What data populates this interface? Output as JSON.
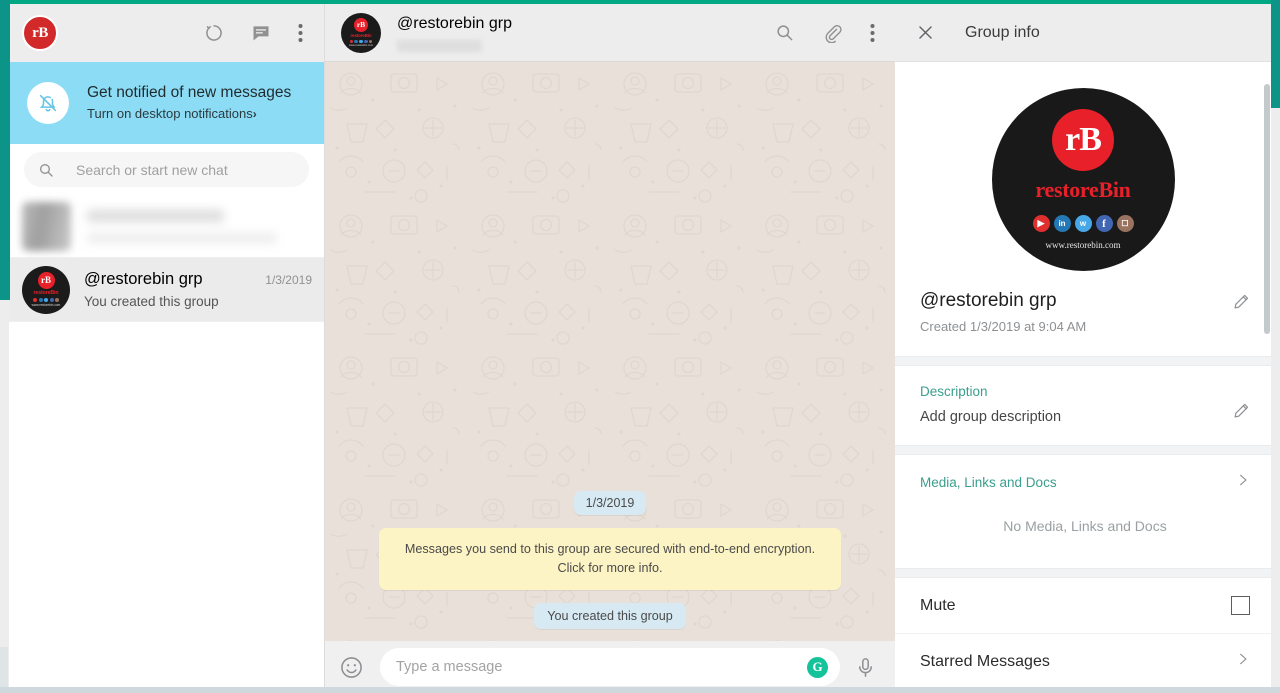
{
  "window": {
    "accent_teal": "#0d9488",
    "top_bar_color": "#00a884"
  },
  "sidebar": {
    "header": {
      "avatar_label": "rB",
      "icons": [
        {
          "name": "status-icon",
          "label": "Status"
        },
        {
          "name": "new-chat-icon",
          "label": "New chat"
        },
        {
          "name": "menu-icon",
          "label": "Menu"
        }
      ]
    },
    "notification_banner": {
      "icon": "bell-slash-icon",
      "title": "Get notified of new messages",
      "subtitle": "Turn on desktop notifications",
      "chevron": "›",
      "background": "#8ddcf5"
    },
    "search": {
      "icon": "search-icon",
      "placeholder": "Search or start new chat",
      "value": ""
    },
    "chats": [
      {
        "redacted": true,
        "name": "",
        "snippet": "",
        "time": ""
      },
      {
        "redacted": false,
        "name": "@restorebin grp",
        "snippet": "You created this group",
        "time": "1/3/2019",
        "active": true,
        "avatar": {
          "mark": "rB",
          "brand": "restoreBin",
          "url": "www.restorebin.com"
        }
      }
    ]
  },
  "chat": {
    "header": {
      "title": "@restorebin grp",
      "subtitle_redacted": true,
      "avatar": {
        "mark": "rB",
        "brand": "restoreBin",
        "url": "www.restorebin.com"
      },
      "icons": [
        {
          "name": "search-icon",
          "label": "Search"
        },
        {
          "name": "attach-icon",
          "label": "Attach"
        },
        {
          "name": "menu-icon",
          "label": "Menu"
        }
      ]
    },
    "messages": {
      "date_divider": "1/3/2019",
      "encryption_notice": "Messages you send to this group are secured with end-to-end encryption. Click for more info.",
      "system_message": "You created this group"
    },
    "composer": {
      "emoji_icon": "emoji-smiley-icon",
      "placeholder": "Type a message",
      "value": "",
      "grammarly_icon": "G",
      "mic_icon": "microphone-icon"
    }
  },
  "group_info": {
    "header": {
      "close_icon": "close-icon",
      "title": "Group info"
    },
    "avatar": {
      "mark": "rB",
      "brand": "restoreBin",
      "url": "www.restorebin.com",
      "social": [
        {
          "name": "youtube-icon",
          "glyph": "▶",
          "color": "#e02f2f"
        },
        {
          "name": "linkedin-icon",
          "glyph": "in",
          "color": "#2478b5"
        },
        {
          "name": "twitter-icon",
          "glyph": "ᴠ",
          "color": "#47a8e8"
        },
        {
          "name": "facebook-icon",
          "glyph": "f",
          "color": "#4267b2"
        },
        {
          "name": "instagram-icon",
          "glyph": "▢",
          "color": "#9a7360"
        }
      ]
    },
    "name": "@restorebin grp",
    "created": "Created 1/3/2019 at 9:04 AM",
    "description": {
      "label": "Description",
      "value": "Add group description"
    },
    "media": {
      "label": "Media, Links and Docs",
      "empty_text": "No Media, Links and Docs"
    },
    "rows": [
      {
        "label": "Mute",
        "control": "checkbox",
        "checked": false
      },
      {
        "label": "Starred Messages",
        "control": "chevron"
      }
    ]
  }
}
